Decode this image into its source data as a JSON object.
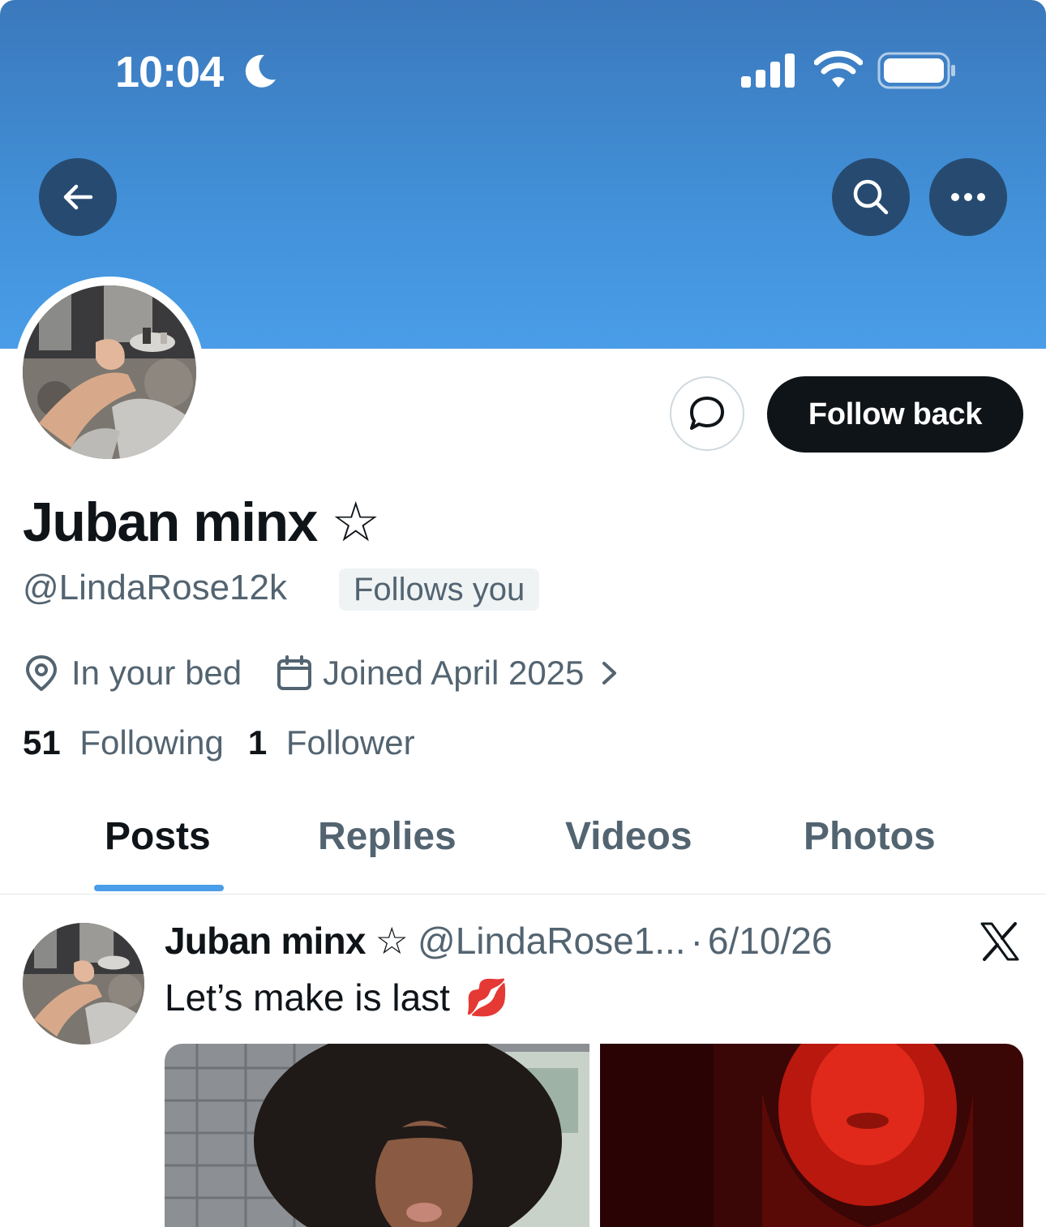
{
  "status_bar": {
    "time": "10:04",
    "focus_icon": "moon-icon",
    "signal_icon": "cellular-signal-icon",
    "wifi_icon": "wifi-icon",
    "battery_icon": "battery-icon"
  },
  "header": {
    "back_icon": "back-arrow-icon",
    "search_icon": "search-icon",
    "more_icon": "more-icon",
    "banner_color": "#4291d9"
  },
  "profile": {
    "display_name": "Juban minx ☆",
    "handle": "@LindaRose12k",
    "follows_you_badge": "Follows you",
    "location": "In your bed",
    "joined": "Joined April 2025",
    "following_count": "51",
    "following_label": "Following",
    "followers_count": "1",
    "followers_label": "Follower"
  },
  "actions": {
    "message_icon": "message-icon",
    "follow_back_label": "Follow back"
  },
  "tabs": [
    {
      "label": "Posts",
      "active": true
    },
    {
      "label": "Replies",
      "active": false
    },
    {
      "label": "Videos",
      "active": false
    },
    {
      "label": "Photos",
      "active": false
    }
  ],
  "post": {
    "author_name": "Juban minx ☆",
    "author_handle": "@LindaRose1...",
    "separator": "·",
    "date": "6/10/26",
    "text": "Let’s make is last",
    "emoji": "💋",
    "source_icon": "x-logo-icon"
  },
  "colors": {
    "accent": "#4a9de8",
    "primary_text": "#0f1419",
    "secondary_text": "#536471",
    "button_dark": "#0f1419",
    "nav_button": "#274b70"
  }
}
